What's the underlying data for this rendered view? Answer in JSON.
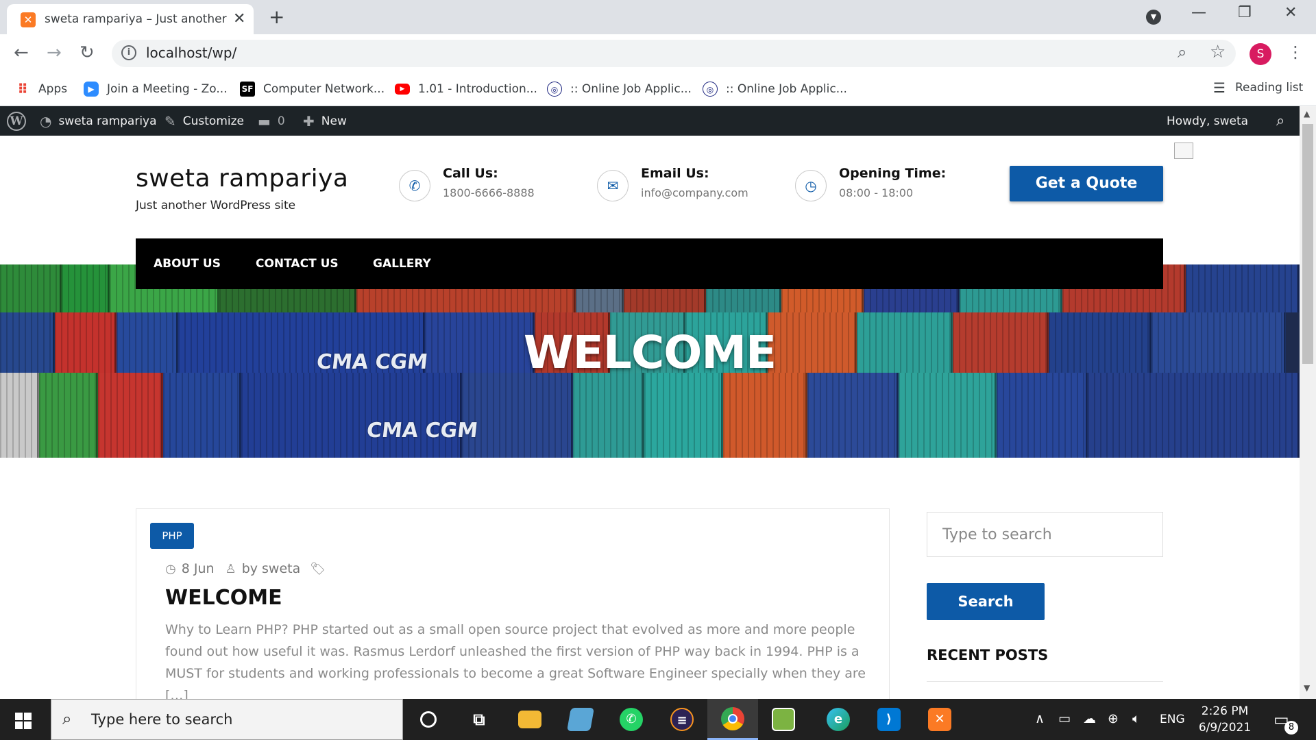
{
  "browser": {
    "tab_title": "sweta rampariya – Just another WordPress site",
    "tab_close": "✕",
    "new_tab": "+",
    "url": "localhost/wp/",
    "profile_initial": "S",
    "bookmarks": [
      {
        "label": "Apps",
        "color": "#ea4335"
      },
      {
        "label": "Join a Meeting - Zo...",
        "color": "#2d8cff"
      },
      {
        "label": "Computer Network...",
        "color": "#000000"
      },
      {
        "label": "1.01 - Introduction...",
        "color": "#ff0000"
      },
      {
        "label": ":: Online Job Applic...",
        "color": "#1a237e"
      },
      {
        "label": ":: Online Job Applic...",
        "color": "#1a237e"
      }
    ],
    "reading_list": "Reading list"
  },
  "adminbar": {
    "site_name": "sweta rampariya",
    "customize": "Customize",
    "comments_count": "0",
    "new_label": "New",
    "howdy": "Howdy, sweta"
  },
  "header": {
    "site_title": "sweta rampariya",
    "tagline": "Just another WordPress site",
    "call_title": "Call Us:",
    "call_value": "1800-6666-8888",
    "email_title": "Email Us:",
    "email_value": "info@company.com",
    "hours_title": "Opening Time:",
    "hours_value": "08:00 - 18:00",
    "quote_button": "Get a Quote"
  },
  "nav": {
    "items": [
      "ABOUT US",
      "CONTACT US",
      "GALLERY"
    ]
  },
  "hero": {
    "title": "WELCOME",
    "container_text_1": "CMA CGM",
    "container_text_2": "CMA CGM"
  },
  "post": {
    "category": "PHP",
    "date": "8 Jun",
    "author": "by sweta",
    "title": "WELCOME",
    "excerpt": "Why to Learn PHP? PHP started out as a small open source project that evolved as more and more people found out how useful it was. Rasmus Lerdorf unleashed the first version of PHP way back in 1994. PHP is a MUST for students and working professionals to become a great Software Engineer specially when they are […]"
  },
  "sidebar": {
    "search_placeholder": "Type to search",
    "search_button": "Search",
    "recent_posts_title": "RECENT POSTS"
  },
  "taskbar": {
    "search_placeholder": "Type here to search",
    "language": "ENG",
    "time": "2:26 PM",
    "date": "6/9/2021",
    "notification_count": "8"
  },
  "colors": {
    "brand_blue": "#0d5aa7",
    "adminbar": "#1d2327",
    "nav": "#000000"
  }
}
